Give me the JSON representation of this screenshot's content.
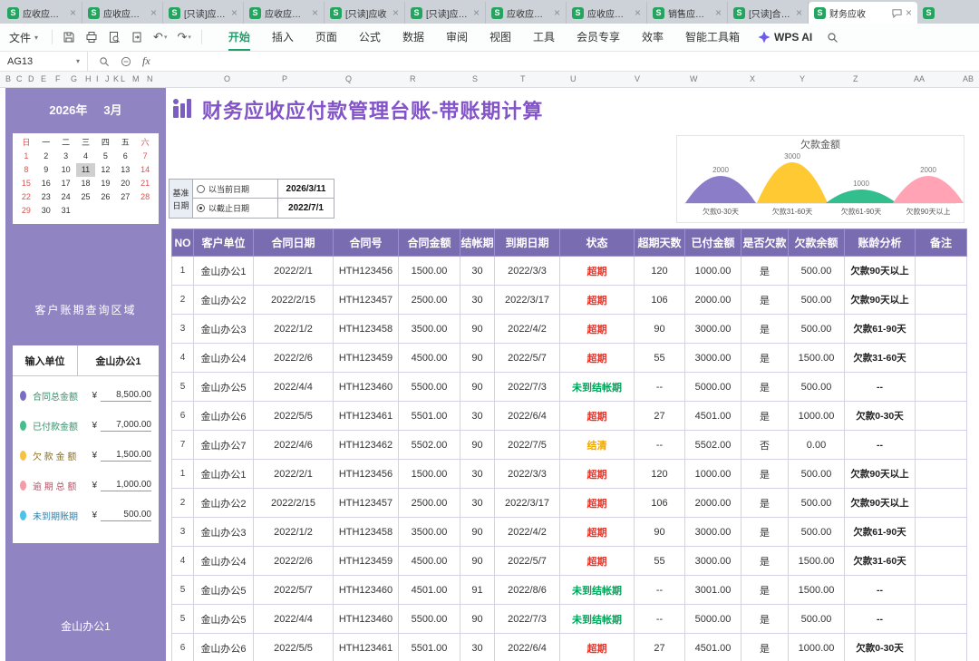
{
  "icons": {
    "file_icon": "S",
    "close": "×",
    "caret_down": "▾",
    "undo": "↶",
    "redo": "↷"
  },
  "tab_bar": {
    "tabs": [
      {
        "label": "应收应付账",
        "active": false
      },
      {
        "label": "应收应付账",
        "active": false
      },
      {
        "label": "[只读]应收账",
        "active": false
      },
      {
        "label": "应收应付统",
        "active": false
      },
      {
        "label": "[只读]应收",
        "active": false
      },
      {
        "label": "[只读]应收账",
        "active": false
      },
      {
        "label": "应收应付管",
        "active": false
      },
      {
        "label": "应收应付登",
        "active": false
      },
      {
        "label": "销售应收应",
        "active": false
      },
      {
        "label": "[只读]合同款",
        "active": false
      },
      {
        "label": "财务应收",
        "active": true
      },
      {
        "label": "",
        "active": false,
        "partial": true
      }
    ]
  },
  "menubar": {
    "file_label": "文件",
    "tabs": [
      "开始",
      "插入",
      "页面",
      "公式",
      "数据",
      "审阅",
      "视图",
      "工具",
      "会员专享",
      "效率",
      "智能工具箱"
    ],
    "active_tab": "开始",
    "ai_label": "WPS AI"
  },
  "formula_bar": {
    "cell_ref": "AG13",
    "fx_label": "fx"
  },
  "columns": {
    "letters": [
      "B",
      "C",
      "D",
      "E",
      "F",
      "G",
      "H",
      "I",
      "J",
      "K",
      "L",
      "M",
      "N",
      "O",
      "P",
      "Q",
      "R",
      "S",
      "T",
      "U",
      "V",
      "W",
      "X",
      "Y",
      "Z",
      "AA",
      "AB"
    ]
  },
  "sidebar": {
    "year": "2026年",
    "month": "3月",
    "weekdays": [
      "日",
      "一",
      "二",
      "三",
      "四",
      "五",
      "六"
    ],
    "calendar_rows": [
      [
        "1",
        "2",
        "3",
        "4",
        "5",
        "6",
        "7"
      ],
      [
        "8",
        "9",
        "10",
        "11",
        "12",
        "13",
        "14"
      ],
      [
        "15",
        "16",
        "17",
        "18",
        "19",
        "20",
        "21"
      ],
      [
        "22",
        "23",
        "24",
        "25",
        "26",
        "27",
        "28"
      ],
      [
        "29",
        "30",
        "31",
        "",
        "",
        "",
        ""
      ]
    ],
    "selected_day": "11",
    "section_title": "客户账期查询区域",
    "input_label": "输入单位",
    "input_value": "金山办公1",
    "legend": [
      {
        "label": "合同总金额",
        "currency": "¥",
        "value": "8,500.00",
        "color": "#7C6BC2",
        "label_color": "#35906B"
      },
      {
        "label": "已付款金额",
        "currency": "¥",
        "value": "7,000.00",
        "color": "#45BE8B",
        "label_color": "#35906B"
      },
      {
        "label": "欠 款 金 额",
        "currency": "¥",
        "value": "1,500.00",
        "color": "#F6C244",
        "label_color": "#8A6D1F"
      },
      {
        "label": "逾 期 总 额",
        "currency": "¥",
        "value": "1,000.00",
        "color": "#F49BAA",
        "label_color": "#B2556A"
      },
      {
        "label": "未到期账期",
        "currency": "¥",
        "value": "500.00",
        "color": "#4EC3EA",
        "label_color": "#2F7FA8"
      }
    ],
    "footer": "金山办公1"
  },
  "main": {
    "title": "财务应收应付款管理台账-带账期计算",
    "base_date": {
      "label_lines": [
        "基准",
        "日期"
      ],
      "options": [
        {
          "label": "以当前日期",
          "value": "2026/3/11",
          "checked": false
        },
        {
          "label": "以截止日期",
          "value": "2022/7/1",
          "checked": true
        }
      ]
    },
    "table": {
      "headers": [
        "NO",
        "客户单位",
        "合同日期",
        "合同号",
        "合同金额",
        "结帐期",
        "到期日期",
        "状态",
        "超期天数",
        "已付金额",
        "是否欠款",
        "欠款余额",
        "账龄分析",
        "备注"
      ],
      "status_colors": {
        "超期": "#EE3124",
        "未到结帐期": "#00A65A",
        "结清": "#F0A800"
      },
      "rows": [
        [
          "1",
          "金山办公1",
          "2022/2/1",
          "HTH123456",
          "1500.00",
          "30",
          "2022/3/3",
          "超期",
          "120",
          "1000.00",
          "是",
          "500.00",
          "欠款90天以上",
          ""
        ],
        [
          "2",
          "金山办公2",
          "2022/2/15",
          "HTH123457",
          "2500.00",
          "30",
          "2022/3/17",
          "超期",
          "106",
          "2000.00",
          "是",
          "500.00",
          "欠款90天以上",
          ""
        ],
        [
          "3",
          "金山办公3",
          "2022/1/2",
          "HTH123458",
          "3500.00",
          "90",
          "2022/4/2",
          "超期",
          "90",
          "3000.00",
          "是",
          "500.00",
          "欠款61-90天",
          ""
        ],
        [
          "4",
          "金山办公4",
          "2022/2/6",
          "HTH123459",
          "4500.00",
          "90",
          "2022/5/7",
          "超期",
          "55",
          "3000.00",
          "是",
          "1500.00",
          "欠款31-60天",
          ""
        ],
        [
          "5",
          "金山办公5",
          "2022/4/4",
          "HTH123460",
          "5500.00",
          "90",
          "2022/7/3",
          "未到结帐期",
          "--",
          "5000.00",
          "是",
          "500.00",
          "--",
          ""
        ],
        [
          "6",
          "金山办公6",
          "2022/5/5",
          "HTH123461",
          "5501.00",
          "30",
          "2022/6/4",
          "超期",
          "27",
          "4501.00",
          "是",
          "1000.00",
          "欠款0-30天",
          ""
        ],
        [
          "7",
          "金山办公7",
          "2022/4/6",
          "HTH123462",
          "5502.00",
          "90",
          "2022/7/5",
          "结清",
          "--",
          "5502.00",
          "否",
          "0.00",
          "--",
          ""
        ],
        [
          "1",
          "金山办公1",
          "2022/2/1",
          "HTH123456",
          "1500.00",
          "30",
          "2022/3/3",
          "超期",
          "120",
          "1000.00",
          "是",
          "500.00",
          "欠款90天以上",
          ""
        ],
        [
          "2",
          "金山办公2",
          "2022/2/15",
          "HTH123457",
          "2500.00",
          "30",
          "2022/3/17",
          "超期",
          "106",
          "2000.00",
          "是",
          "500.00",
          "欠款90天以上",
          ""
        ],
        [
          "3",
          "金山办公3",
          "2022/1/2",
          "HTH123458",
          "3500.00",
          "90",
          "2022/4/2",
          "超期",
          "90",
          "3000.00",
          "是",
          "500.00",
          "欠款61-90天",
          ""
        ],
        [
          "4",
          "金山办公4",
          "2022/2/6",
          "HTH123459",
          "4500.00",
          "90",
          "2022/5/7",
          "超期",
          "55",
          "3000.00",
          "是",
          "1500.00",
          "欠款31-60天",
          ""
        ],
        [
          "5",
          "金山办公5",
          "2022/5/7",
          "HTH123460",
          "4501.00",
          "91",
          "2022/8/6",
          "未到结帐期",
          "--",
          "3001.00",
          "是",
          "1500.00",
          "--",
          ""
        ],
        [
          "5",
          "金山办公5",
          "2022/4/4",
          "HTH123460",
          "5500.00",
          "90",
          "2022/7/3",
          "未到结帐期",
          "--",
          "5000.00",
          "是",
          "500.00",
          "--",
          ""
        ],
        [
          "6",
          "金山办公6",
          "2022/5/5",
          "HTH123461",
          "5501.00",
          "30",
          "2022/6/4",
          "超期",
          "27",
          "4501.00",
          "是",
          "1000.00",
          "欠款0-30天",
          ""
        ]
      ]
    }
  },
  "chart_data": {
    "type": "area",
    "title": "欠款金额",
    "categories": [
      "欠款0-30天",
      "欠款31-60天",
      "欠款61-90天",
      "欠款90天以上"
    ],
    "values": [
      2000,
      3000,
      1000,
      2000
    ],
    "colors": [
      "#8B7DC8",
      "#FFC933",
      "#33BE8D",
      "#FFA3B5"
    ],
    "ylim": [
      0,
      3000
    ],
    "legend_position": "none",
    "grid": false
  }
}
